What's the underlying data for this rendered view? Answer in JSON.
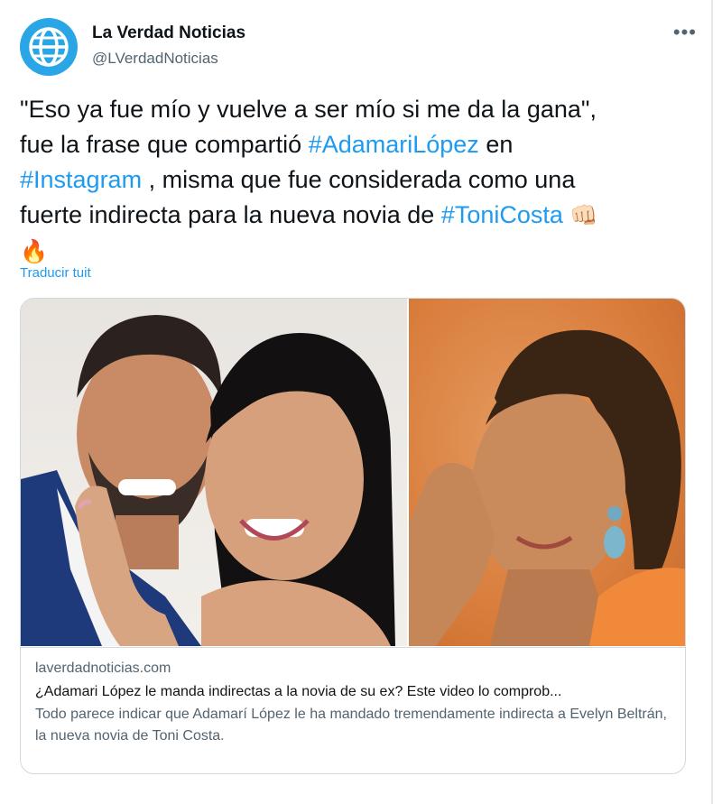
{
  "account": {
    "name": "La Verdad Noticias",
    "handle": "@LVerdadNoticias"
  },
  "tweet": {
    "text_1": "\"Eso ya fue mío y vuelve a ser mío si me da la gana\",",
    "text_2": "fue la frase que compartió ",
    "hashtag_1": "#AdamariLópez",
    "text_3": " en",
    "hashtag_2": "#Instagram",
    "text_4": " , misma que fue considerada como una",
    "text_5": "fuerte indirecta para la nueva novia de ",
    "hashtag_3": "#ToniCosta",
    "emoji_fist": "👊🏻",
    "emoji_fire": "🔥"
  },
  "translate_label": "Traducir tuit",
  "card": {
    "domain": "laverdadnoticias.com",
    "title": "¿Adamari López le manda indirectas a la novia de su ex? Este video lo comprob...",
    "description": "Todo parece indicar que Adamarí López le ha mandado tremendamente indirecta a Evelyn Beltrán, la nueva novia de Toni Costa."
  },
  "colors": {
    "link": "#1d9bf0",
    "secondary_text": "#536471",
    "avatar": "#2aa6e6"
  },
  "icons": {
    "avatar": "globe-icon",
    "more": "more-options-icon"
  }
}
